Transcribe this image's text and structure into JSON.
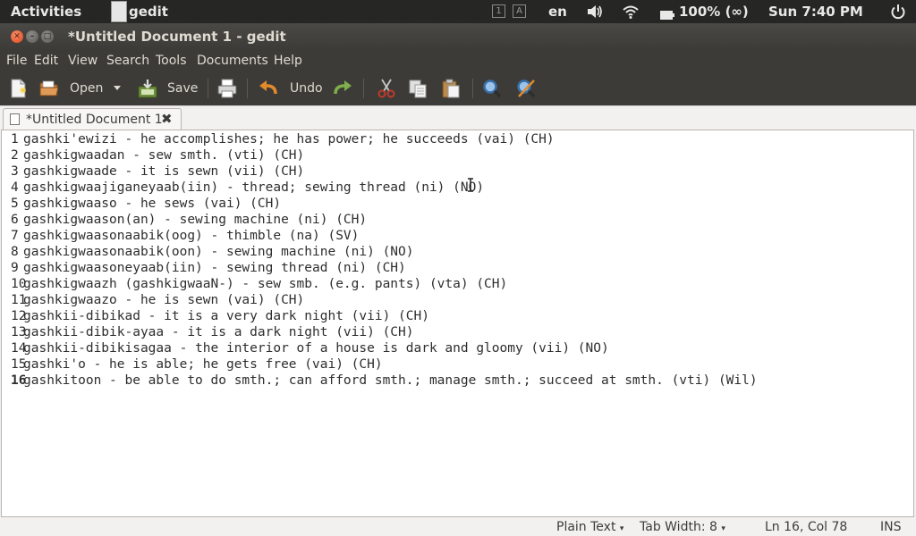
{
  "top_panel": {
    "activities": "Activities",
    "app_name": "gedit",
    "workspaces": [
      "1",
      "A"
    ],
    "keyboard": "en",
    "battery": "100% (∞)",
    "clock": "Sun  7:40 PM"
  },
  "window": {
    "title": "*Untitled Document 1 - gedit"
  },
  "menubar": {
    "items": [
      "File",
      "Edit",
      "View",
      "Search",
      "Tools",
      "Documents",
      "Help"
    ]
  },
  "toolbar": {
    "open_label": "Open",
    "save_label": "Save",
    "undo_label": "Undo"
  },
  "tab": {
    "label": "*Untitled Document 1"
  },
  "editor": {
    "lines": [
      {
        "num": "1",
        "text": "gashki'ewizi - he accomplishes; he has power; he succeeds (vai) (CH)"
      },
      {
        "num": "2",
        "text": "gashkigwaadan - sew smth. (vti) (CH)"
      },
      {
        "num": "3",
        "text": "gashkigwaade - it is sewn (vii) (CH)"
      },
      {
        "num": "4",
        "text": "gashkigwaajiganeyaab(iin) - thread; sewing thread (ni) (NO)"
      },
      {
        "num": "5",
        "text": "gashkigwaaso - he sews (vai) (CH)"
      },
      {
        "num": "6",
        "text": "gashkigwaason(an) - sewing machine (ni) (CH)"
      },
      {
        "num": "7",
        "text": "gashkigwaasonaabik(oog) - thimble (na) (SV)"
      },
      {
        "num": "8",
        "text": "gashkigwaasonaabik(oon) - sewing machine (ni) (NO)"
      },
      {
        "num": "9",
        "text": "gashkigwaasoneyaab(iin) - sewing thread (ni) (CH)"
      },
      {
        "num": "10",
        "text": "gashkigwaazh (gashkigwaaN-) - sew smb. (e.g. pants) (vta) (CH)"
      },
      {
        "num": "11",
        "text": "gashkigwaazo - he is sewn (vai) (CH)"
      },
      {
        "num": "12",
        "text": "gashkii-dibikad - it is a very dark night (vii) (CH)"
      },
      {
        "num": "13",
        "text": "gashkii-dibik-ayaa - it is a dark night (vii) (CH)"
      },
      {
        "num": "14",
        "text": "gashkii-dibikisagaa - the interior of a house is dark and gloomy (vii) (NO)"
      },
      {
        "num": "15",
        "text": "gashki'o - he is able; he gets free (vai) (CH)"
      },
      {
        "num": "16",
        "text": "gashkitoon - be able to do smth.; can afford smth.; manage smth.; succeed at smth. (vti) (Wil)"
      }
    ]
  },
  "statusbar": {
    "language": "Plain Text",
    "tab_width": "Tab Width:  8",
    "position": "Ln 16, Col 78",
    "mode": "INS"
  },
  "colors": {
    "panel": "#262624",
    "chrome": "#3c3b37",
    "close_button": "#e0441c",
    "undo_arrow": "#e08a2c",
    "redo_arrow": "#7fae4a"
  }
}
